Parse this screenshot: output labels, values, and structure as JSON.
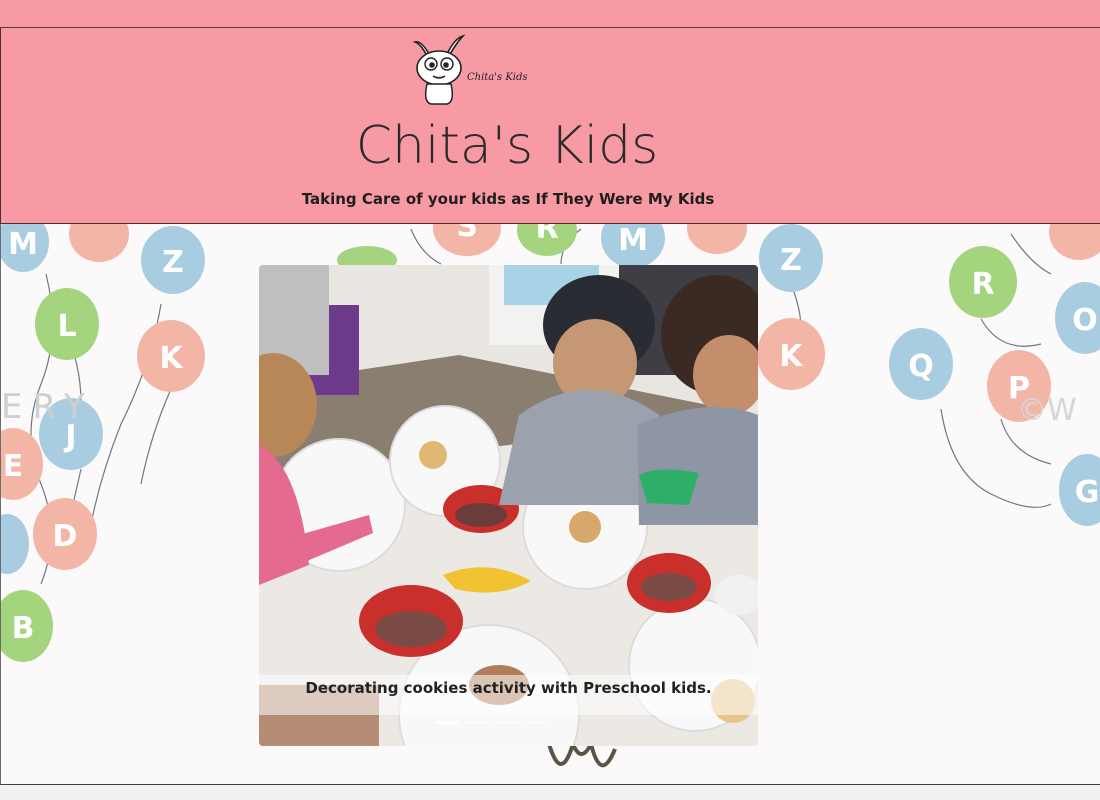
{
  "header": {
    "logo_text": "Chita's Kids",
    "title": "Chita's Kids",
    "tagline": "Taking Care of your kids as If They Were My Kids"
  },
  "carousel": {
    "caption": "Decorating cookies activity with Preschool kids.",
    "slide_count": 4,
    "active_index": 0
  },
  "colors": {
    "header_bg": "#f79aa4",
    "balloon_blue": "#a9cde0",
    "balloon_green": "#a4d47e",
    "balloon_pink": "#f2b5a6"
  },
  "background": {
    "balloon_letters": [
      "M",
      "L",
      "K",
      "J",
      "E",
      "D",
      "B",
      "Z",
      "S",
      "R",
      "M",
      "K",
      "Z",
      "R",
      "Q",
      "P",
      "O",
      "W",
      "G",
      "C"
    ],
    "faint_text_left": "ERY",
    "faint_text_right": "©W"
  }
}
